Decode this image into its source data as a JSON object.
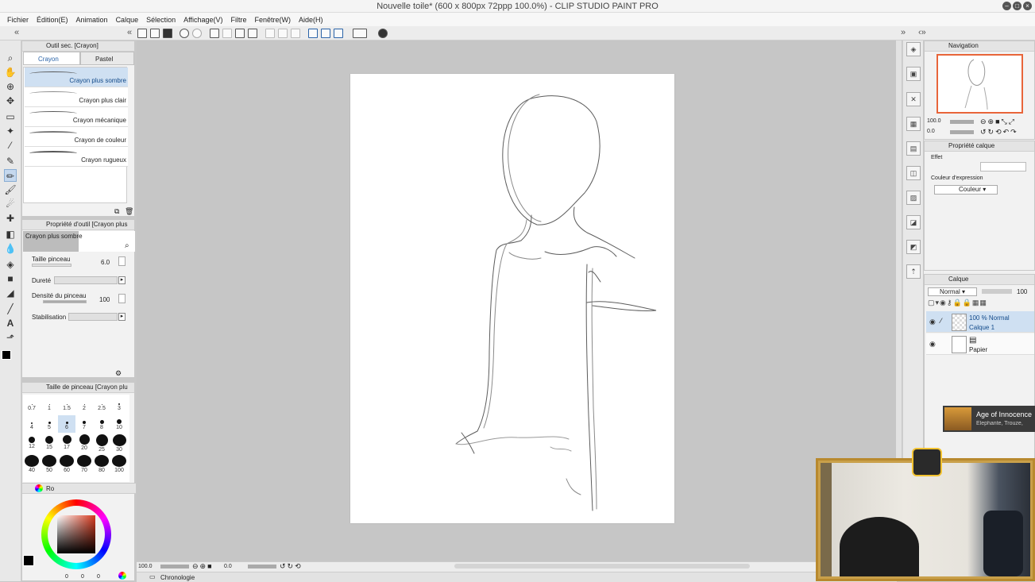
{
  "window": {
    "title": "Nouvelle toile* (600 x 800px 72ppp 100.0%) - CLIP STUDIO PAINT PRO"
  },
  "menu": [
    "Fichier",
    "Édition(E)",
    "Animation",
    "Calque",
    "Sélection",
    "Affichage(V)",
    "Filtre",
    "Fenêtre(W)",
    "Aide(H)"
  ],
  "subtool_panel": {
    "title": "Outil sec. [Crayon]",
    "tabs": [
      "Crayon",
      "Pastel"
    ],
    "brushes": [
      "Crayon plus sombre",
      "Crayon plus clair",
      "Crayon mécanique",
      "Crayon de couleur",
      "Crayon rugueux"
    ],
    "selected_index": 0
  },
  "tool_property": {
    "title": "Propriété d'outil [Crayon plus",
    "preset_name": "Crayon plus sombre",
    "brush_size_label": "Taille pinceau",
    "brush_size_value": "6.0",
    "hardness_label": "Dureté",
    "density_label": "Densité du pinceau",
    "density_value": "100",
    "stabilization_label": "Stabilisation"
  },
  "brush_size_panel": {
    "title": "Taille de pinceau [Crayon plu",
    "sizes": [
      "0.7",
      "1",
      "1.5",
      "2",
      "2.5",
      "3",
      "4",
      "5",
      "6",
      "7",
      "8",
      "10",
      "12",
      "15",
      "17",
      "20",
      "25",
      "30",
      "40",
      "50",
      "60",
      "70",
      "80",
      "100"
    ],
    "selected": "6"
  },
  "color_panel": {
    "tab_label": "Ro",
    "values": [
      "0",
      "0",
      "0"
    ]
  },
  "navigation": {
    "title": "Navigation",
    "zoom_value": "100.0",
    "rotate_value": "0.0"
  },
  "layer_property": {
    "title": "Propriété calque",
    "effect_label": "Effet",
    "expression_color_label": "Couleur d'expression",
    "expression_color_value": "Couleur"
  },
  "layers": {
    "title": "Calque",
    "blend_mode": "Normal",
    "opacity": "100",
    "items": [
      {
        "name": "Calque 1",
        "info": "100 %  Normal"
      },
      {
        "name": "Papier",
        "info": ""
      }
    ]
  },
  "bottom": {
    "zoom_value": "100.0",
    "rotate_value": "0.0",
    "timeline_label": "Chronologie"
  },
  "notification": {
    "title": "Age of Innocence",
    "subtitle": "Elephante, Trouze,"
  },
  "colors": {
    "accent": "#2a63a8",
    "nav_frame": "#e8653a",
    "selection": "#cfe0f2"
  }
}
